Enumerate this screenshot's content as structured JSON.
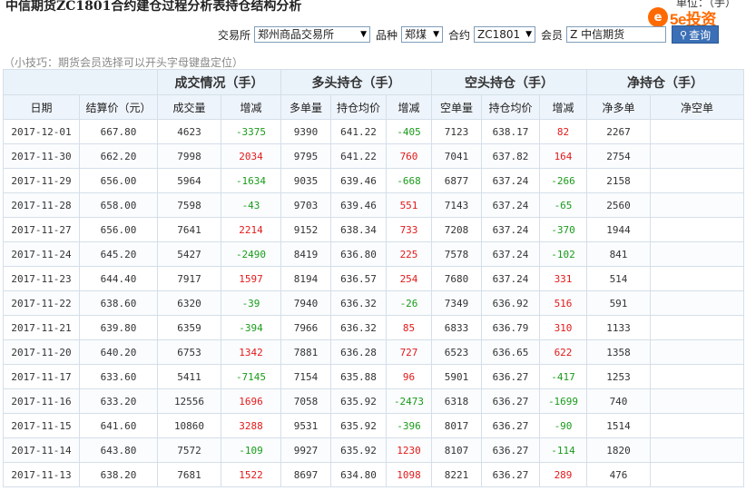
{
  "header": {
    "title": "中信期货ZC1801合约建仓过程分析表持仓结构分析",
    "unit": "单位：（手）",
    "logo_text": "5e投资"
  },
  "filters": {
    "exchange_label": "交易所",
    "exchange_value": "郑州商品交易所",
    "variety_label": "品种",
    "variety_value": "郑煤",
    "contract_label": "合约",
    "contract_value": "ZC1801",
    "member_label": "会员",
    "member_value": "Z 中信期货",
    "search_button": "查询"
  },
  "tip": "（小技巧：期货会员选择可以开头字母键盘定位）",
  "table": {
    "groups": [
      "成交情况（手）",
      "多头持仓（手）",
      "空头持仓（手）",
      "净持仓（手）"
    ],
    "columns": [
      "日期",
      "结算价（元）",
      "成交量",
      "增减",
      "多单量",
      "持仓均价",
      "增减",
      "空单量",
      "持仓均价",
      "增减",
      "净多单",
      "净空单"
    ],
    "rows": [
      [
        "2017-12-01",
        "667.80",
        "4623",
        "-3375",
        "9390",
        "641.22",
        "-405",
        "7123",
        "638.17",
        "82",
        "2267",
        ""
      ],
      [
        "2017-11-30",
        "662.20",
        "7998",
        "2034",
        "9795",
        "641.22",
        "760",
        "7041",
        "637.82",
        "164",
        "2754",
        ""
      ],
      [
        "2017-11-29",
        "656.00",
        "5964",
        "-1634",
        "9035",
        "639.46",
        "-668",
        "6877",
        "637.24",
        "-266",
        "2158",
        ""
      ],
      [
        "2017-11-28",
        "658.00",
        "7598",
        "-43",
        "9703",
        "639.46",
        "551",
        "7143",
        "637.24",
        "-65",
        "2560",
        ""
      ],
      [
        "2017-11-27",
        "656.00",
        "7641",
        "2214",
        "9152",
        "638.34",
        "733",
        "7208",
        "637.24",
        "-370",
        "1944",
        ""
      ],
      [
        "2017-11-24",
        "645.20",
        "5427",
        "-2490",
        "8419",
        "636.80",
        "225",
        "7578",
        "637.24",
        "-102",
        "841",
        ""
      ],
      [
        "2017-11-23",
        "644.40",
        "7917",
        "1597",
        "8194",
        "636.57",
        "254",
        "7680",
        "637.24",
        "331",
        "514",
        ""
      ],
      [
        "2017-11-22",
        "638.60",
        "6320",
        "-39",
        "7940",
        "636.32",
        "-26",
        "7349",
        "636.92",
        "516",
        "591",
        ""
      ],
      [
        "2017-11-21",
        "639.80",
        "6359",
        "-394",
        "7966",
        "636.32",
        "85",
        "6833",
        "636.79",
        "310",
        "1133",
        ""
      ],
      [
        "2017-11-20",
        "640.20",
        "6753",
        "1342",
        "7881",
        "636.28",
        "727",
        "6523",
        "636.65",
        "622",
        "1358",
        ""
      ],
      [
        "2017-11-17",
        "633.60",
        "5411",
        "-7145",
        "7154",
        "635.88",
        "96",
        "5901",
        "636.27",
        "-417",
        "1253",
        ""
      ],
      [
        "2017-11-16",
        "633.20",
        "12556",
        "1696",
        "7058",
        "635.92",
        "-2473",
        "6318",
        "636.27",
        "-1699",
        "740",
        ""
      ],
      [
        "2017-11-15",
        "641.60",
        "10860",
        "3288",
        "9531",
        "635.92",
        "-396",
        "8017",
        "636.27",
        "-90",
        "1514",
        ""
      ],
      [
        "2017-11-14",
        "643.80",
        "7572",
        "-109",
        "9927",
        "635.92",
        "1230",
        "8107",
        "636.27",
        "-114",
        "1820",
        ""
      ],
      [
        "2017-11-13",
        "638.20",
        "7681",
        "1522",
        "8697",
        "634.80",
        "1098",
        "8221",
        "636.27",
        "289",
        "476",
        ""
      ]
    ]
  },
  "colors": {
    "increase": "#e31a1a",
    "decrease": "#1a9b1a",
    "header_bg": "#eaf2fa",
    "button": "#3b6fb6"
  }
}
